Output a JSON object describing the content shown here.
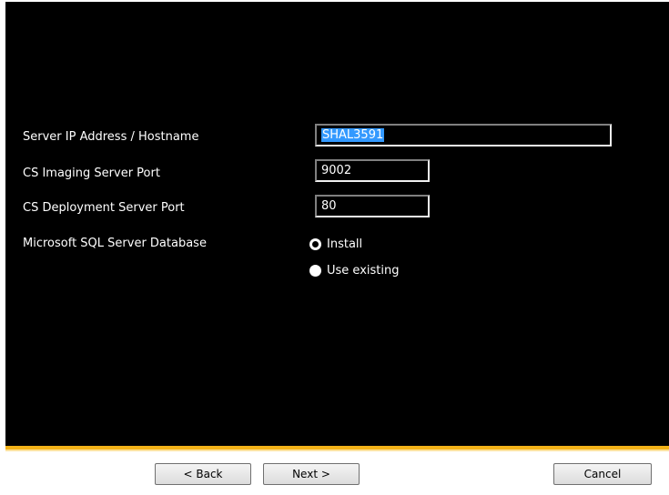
{
  "form": {
    "server_ip_label": "Server IP Address / Hostname",
    "server_ip_value": "SHAL3591",
    "imaging_port_label": "CS Imaging Server Port",
    "imaging_port_value": "9002",
    "deployment_port_label": "CS Deployment Server Port",
    "deployment_port_value": "80",
    "sql_label": "Microsoft SQL Server Database",
    "sql_options": [
      {
        "label": "Install",
        "selected": true
      },
      {
        "label": "Use existing",
        "selected": false
      }
    ]
  },
  "buttons": {
    "back": "< Back",
    "next": "Next >",
    "cancel": "Cancel"
  },
  "colors": {
    "background": "#000000",
    "accent": "#f3b218",
    "selection": "#3399ff"
  }
}
